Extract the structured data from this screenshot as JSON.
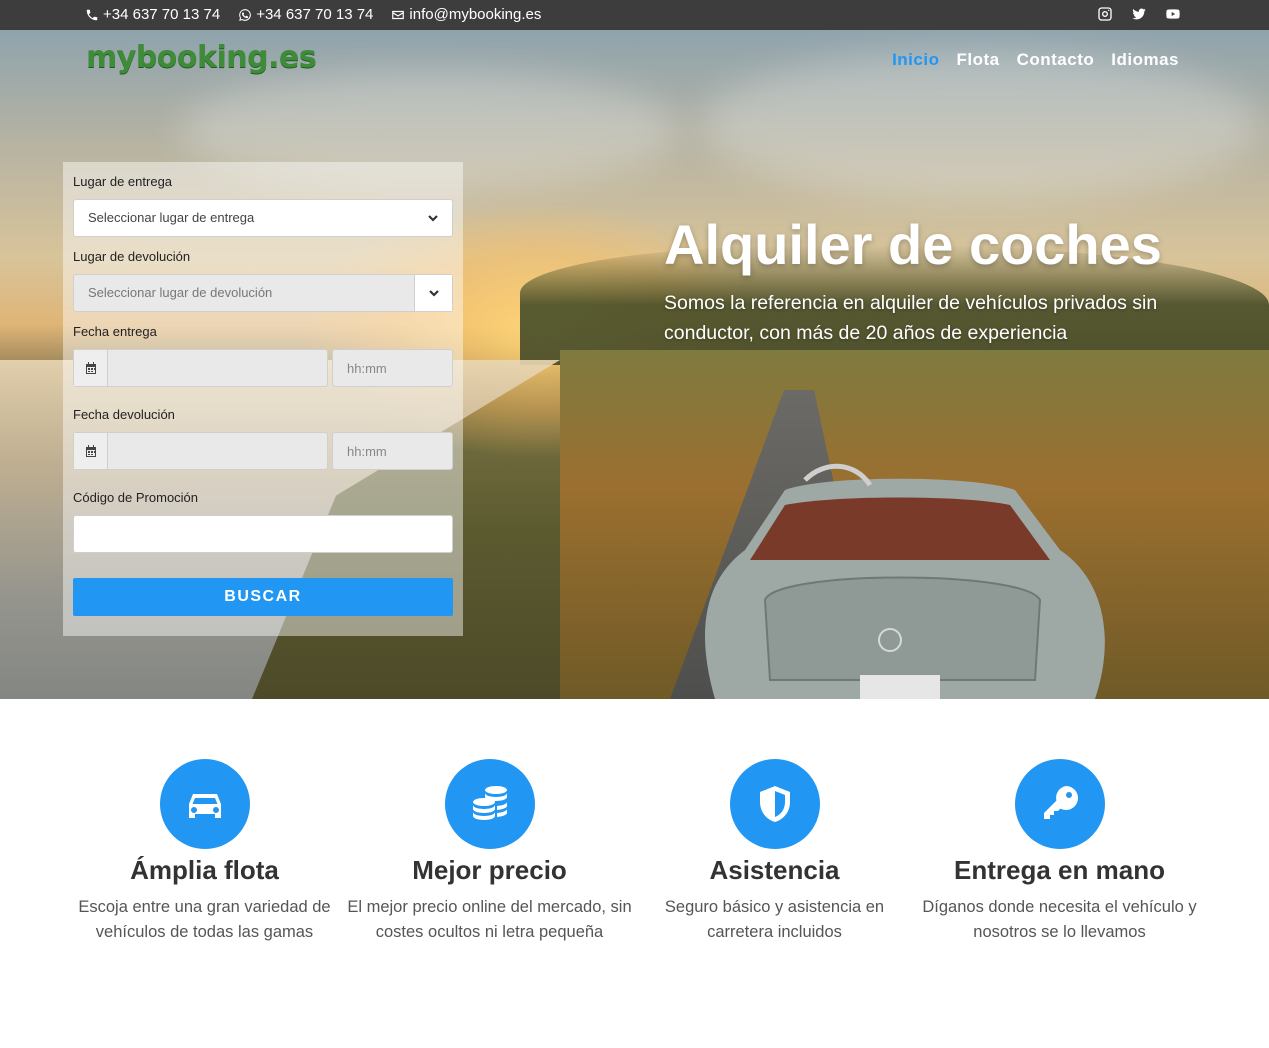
{
  "topbar": {
    "phone": "+34 637 70 13 74",
    "whatsapp": "+34 637 70 13 74",
    "email": "info@mybooking.es",
    "social": [
      "instagram-icon",
      "twitter-icon",
      "youtube-icon"
    ]
  },
  "header": {
    "logo": "mybooking.es",
    "nav": [
      {
        "label": "Inicio",
        "active": true
      },
      {
        "label": "Flota",
        "active": false
      },
      {
        "label": "Contacto",
        "active": false
      },
      {
        "label": "Idiomas",
        "active": false
      }
    ]
  },
  "search": {
    "pickup_label": "Lugar de entrega",
    "pickup_value": "Seleccionar lugar de entrega",
    "return_label": "Lugar de devolución",
    "return_value": "Seleccionar lugar de devolución",
    "pickup_date_label": "Fecha entrega",
    "pickup_time_placeholder": "hh:mm",
    "return_date_label": "Fecha devolución",
    "return_time_placeholder": "hh:mm",
    "promo_label": "Código de Promoción",
    "submit_label": "BUSCAR"
  },
  "hero": {
    "title": "Alquiler de coches",
    "subtitle": "Somos la referencia en alquiler de vehículos privados sin conductor, con más de 20 años de experiencia"
  },
  "features": [
    {
      "icon": "car-icon",
      "title": "Ámplia flota",
      "text": "Escoja entre una gran variedad de vehículos de todas las gamas"
    },
    {
      "icon": "coins-icon",
      "title": "Mejor precio",
      "text": "El mejor precio online del mercado, sin costes ocultos ni letra pequeña"
    },
    {
      "icon": "shield-icon",
      "title": "Asistencia",
      "text": "Seguro básico y asistencia en carretera incluidos"
    },
    {
      "icon": "key-icon",
      "title": "Entrega en mano",
      "text": "Díganos donde necesita el vehículo y nosotros se lo llevamos"
    }
  ],
  "colors": {
    "accent": "#2196f3",
    "topbar": "#3d3d3d",
    "logo": "#3e8b3a"
  }
}
